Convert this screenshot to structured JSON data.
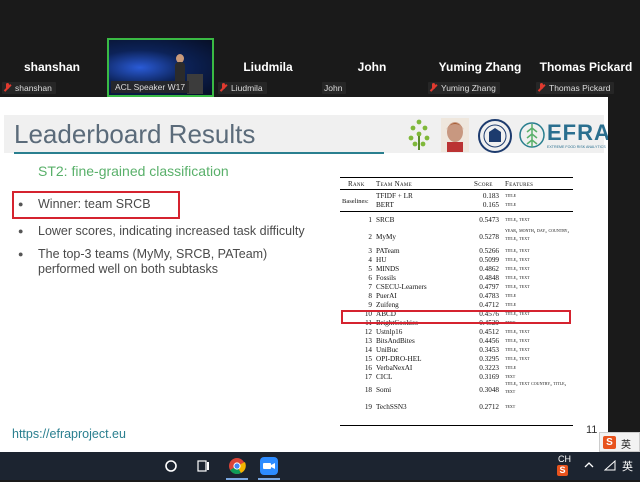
{
  "participants": [
    {
      "name": "shanshan",
      "label": "shanshan",
      "muted": true
    },
    {
      "name": "",
      "label": "ACL Speaker W17",
      "muted": false,
      "video": true
    },
    {
      "name": "Liudmila",
      "label": "Liudmila",
      "muted": true
    },
    {
      "name": "John",
      "label": "John",
      "muted": false
    },
    {
      "name": "Yuming Zhang",
      "label": "Yuming Zhang",
      "muted": true
    },
    {
      "name": "Thomas Pickard",
      "label": "Thomas Pickard",
      "muted": true
    }
  ],
  "slide": {
    "title": "Leaderboard Results",
    "subtitle": "ST2: fine-grained classification",
    "bullets": [
      "Winner: team SRCB",
      "Lower scores, indicating increased task difficulty",
      "The top-3 teams (MyMy, SRCB, PATeam) performed well on both subtasks"
    ],
    "link": "https://efraproject.eu",
    "page_number": "11",
    "logos": [
      "leaf-graph-logo",
      "portrait-logo",
      "university-seal-logo",
      "efra-wheat-logo"
    ],
    "efra_text": "EFRA",
    "efra_tagline": "EXTREME FOOD RISK ANALYTICS"
  },
  "table": {
    "headers": {
      "rank": "Rank",
      "team": "Team Name",
      "score": "Score",
      "features": "Features"
    },
    "baselines_label": "Baselines:",
    "baselines": [
      {
        "team": "TFIDF + LR",
        "score": "0.183",
        "features": "title"
      },
      {
        "team": "BERT",
        "score": "0.165",
        "features": "title"
      }
    ],
    "rows": [
      {
        "rank": "1",
        "team": "SRCB",
        "score": "0.5473",
        "features": "title, text"
      },
      {
        "rank": "2",
        "team": "MyMy",
        "score": "0.5278",
        "features": "year, month, day, country, title, text"
      },
      {
        "rank": "3",
        "team": "PATeam",
        "score": "0.5266",
        "features": "title, text"
      },
      {
        "rank": "4",
        "team": "HU",
        "score": "0.5099",
        "features": "title, text"
      },
      {
        "rank": "5",
        "team": "MINDS",
        "score": "0.4862",
        "features": "title, text"
      },
      {
        "rank": "6",
        "team": "Fossils",
        "score": "0.4848",
        "features": "title, text"
      },
      {
        "rank": "7",
        "team": "CSECU-Learners",
        "score": "0.4797",
        "features": "title, text"
      },
      {
        "rank": "8",
        "team": "PuerAI",
        "score": "0.4783",
        "features": "title"
      },
      {
        "rank": "9",
        "team": "Zuifeng",
        "score": "0.4712",
        "features": "title"
      },
      {
        "rank": "10",
        "team": "ABCD",
        "score": "0.4576",
        "features": "title, text"
      },
      {
        "rank": "11",
        "team": "BrightCookies",
        "score": "0.4529",
        "features": "text"
      },
      {
        "rank": "12",
        "team": "Ustnlp16",
        "score": "0.4512",
        "features": "title, text"
      },
      {
        "rank": "13",
        "team": "BitsAndBites",
        "score": "0.4456",
        "features": "title, text"
      },
      {
        "rank": "14",
        "team": "UniBuc",
        "score": "0.3453",
        "features": "title, text"
      },
      {
        "rank": "15",
        "team": "OPI-DRO-HEL",
        "score": "0.3295",
        "features": "title, text"
      },
      {
        "rank": "16",
        "team": "VerbaNexAI",
        "score": "0.3223",
        "features": "title"
      },
      {
        "rank": "17",
        "team": "CICL",
        "score": "0.3169",
        "features": "text"
      },
      {
        "rank": "18",
        "team": "Somi",
        "score": "0.3048",
        "features": "title, text country, title, text"
      },
      {
        "rank": "19",
        "team": "TechSSN3",
        "score": "0.2712",
        "features": "text"
      }
    ]
  },
  "taskbar": {
    "icons": [
      "search-circle-icon",
      "task-view-icon",
      "chrome-icon",
      "zoom-icon"
    ],
    "ime_label": "CH",
    "lang": "英",
    "tray": [
      "chevron-up-icon",
      "network-icon",
      "lang-indicator"
    ]
  },
  "colors": {
    "accent_teal": "#2a7f8f",
    "subtitle_green": "#59b06a",
    "highlight_red": "#d5232f",
    "active_speaker_green": "#3aba44"
  }
}
